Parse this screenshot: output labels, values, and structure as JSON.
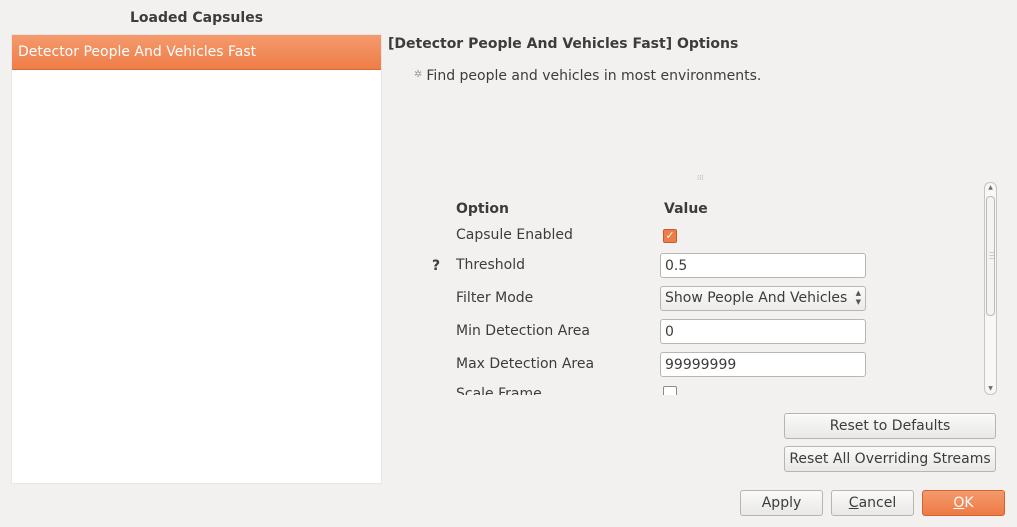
{
  "capsules": {
    "title": "Loaded Capsules",
    "items": [
      {
        "label": "Detector People And Vehicles Fast"
      }
    ]
  },
  "options": {
    "title": "[Detector People And Vehicles Fast] Options",
    "description": "Find people and vehicles in most environments.",
    "description_icon": "sparkle-icon",
    "splitter_grip": "⁞⁞⁞",
    "help_marker": "?",
    "table": {
      "headers": {
        "option": "Option",
        "value": "Value"
      },
      "rows": [
        {
          "label": "Capsule Enabled",
          "type": "checkbox",
          "checked": true
        },
        {
          "label": "Threshold",
          "type": "text",
          "value": "0.5",
          "has_help": true
        },
        {
          "label": "Filter Mode",
          "type": "select",
          "value": "Show People And Vehicles"
        },
        {
          "label": "Min Detection Area",
          "type": "text",
          "value": "0"
        },
        {
          "label": "Max Detection Area",
          "type": "text",
          "value": "99999999"
        },
        {
          "label": "Scale Frame",
          "type": "checkbox",
          "checked": false
        }
      ]
    },
    "reset_defaults": "Reset to Defaults",
    "reset_overriding": "Reset All Overriding Streams"
  },
  "dialog": {
    "apply": "Apply",
    "cancel_first": "C",
    "cancel_rest": "ancel",
    "ok_first": "O",
    "ok_rest": "K"
  },
  "colors": {
    "accent": "#ef7d48",
    "background": "#f2f1f0",
    "text": "#3c3c3c"
  }
}
